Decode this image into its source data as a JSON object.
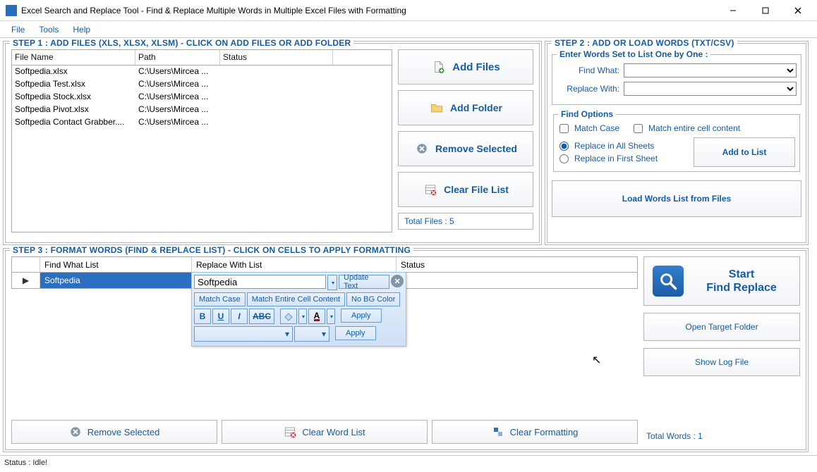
{
  "window": {
    "title": "Excel Search and Replace Tool - Find & Replace Multiple Words in Multiple Excel Files with Formatting"
  },
  "menu": {
    "file": "File",
    "tools": "Tools",
    "help": "Help"
  },
  "step1": {
    "title": "STEP 1 : ADD FILES (XLS, XLSX, XLSM) - CLICK ON ADD FILES OR ADD FOLDER",
    "cols": {
      "filename": "File Name",
      "path": "Path",
      "status": "Status"
    },
    "rows": [
      {
        "name": "Softpedia.xlsx",
        "path": "C:\\Users\\Mircea ...",
        "status": ""
      },
      {
        "name": "Softpedia Test.xlsx",
        "path": "C:\\Users\\Mircea ...",
        "status": ""
      },
      {
        "name": "Softpedia Stock.xlsx",
        "path": "C:\\Users\\Mircea ...",
        "status": ""
      },
      {
        "name": "Softpedia Pivot.xlsx",
        "path": "C:\\Users\\Mircea ...",
        "status": ""
      },
      {
        "name": "Softpedia Contact Grabber....",
        "path": "C:\\Users\\Mircea ...",
        "status": ""
      }
    ],
    "buttons": {
      "add_files": "Add Files",
      "add_folder": "Add Folder",
      "remove_selected": "Remove Selected",
      "clear_list": "Clear File List"
    },
    "total_files": "Total Files : 5"
  },
  "step2": {
    "title": "STEP 2 : ADD OR LOAD WORDS (TXT/CSV)",
    "enter_label": "Enter Words Set to List One by One :",
    "find_what": "Find What:",
    "replace_with": "Replace With:",
    "find_options": "Find Options",
    "match_case": "Match Case",
    "match_entire": "Match entire cell content",
    "replace_all": "Replace in All Sheets",
    "replace_first": "Replace in First Sheet",
    "add_to_list": "Add to List",
    "load_words": "Load Words List from Files"
  },
  "step3": {
    "title": "STEP 3 : FORMAT WORDS (FIND & REPLACE LIST) - CLICK ON CELLS TO APPLY FORMATTING",
    "cols": {
      "find": "Find What List",
      "replace": "Replace With List",
      "status": "Status"
    },
    "row_find": "Softpedia",
    "editor": {
      "text_value": "Softpedia",
      "update_text": "Update Text",
      "match_case": "Match Case",
      "match_entire": "Match Entire Cell Content",
      "no_bg": "No BG Color",
      "bold": "B",
      "underline": "U",
      "italic": "I",
      "strike": "ABC",
      "font_color": "A",
      "apply1": "Apply",
      "apply2": "Apply"
    },
    "bottom": {
      "remove": "Remove Selected",
      "clear_word": "Clear Word List",
      "clear_fmt": "Clear Formatting"
    },
    "start_l1": "Start",
    "start_l2": "Find Replace",
    "open_target": "Open Target Folder",
    "show_log": "Show Log File",
    "total_words": "Total Words : 1"
  },
  "status": "Status  :  Idle!"
}
